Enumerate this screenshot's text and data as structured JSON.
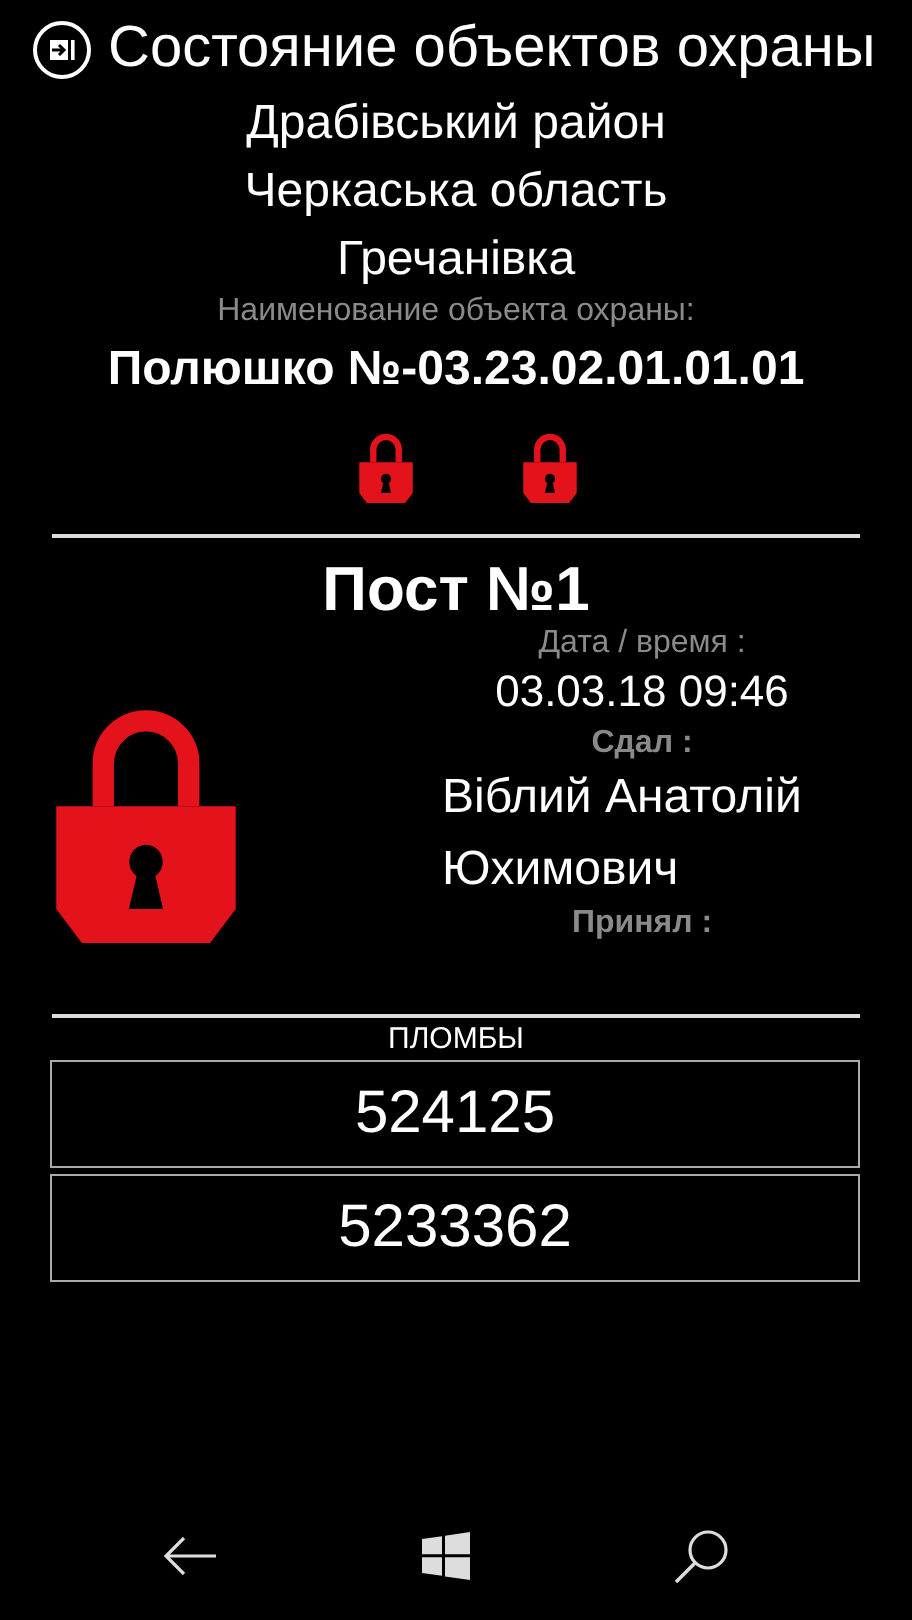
{
  "header": {
    "title": "Состояние объектов охраны"
  },
  "location": [
    "Драбівський район",
    "Черкаська область",
    "Гречанівка"
  ],
  "object": {
    "label": "Наименование объекта охраны:",
    "name": "Полюшко №-03.23.02.01.01.01"
  },
  "locks": [
    {
      "locked": true
    },
    {
      "locked": true
    }
  ],
  "post": {
    "title": "Пост №1",
    "locked": true,
    "date_label": "Дата / время :",
    "date": "03.03.18 09:46",
    "handed_label": "Сдал :",
    "handed_by": "Віблий Анатолій Юхимович",
    "received_label": "Принял :"
  },
  "seals": {
    "title": "ПЛОМБЫ",
    "items": [
      "524125",
      "5233362"
    ]
  }
}
